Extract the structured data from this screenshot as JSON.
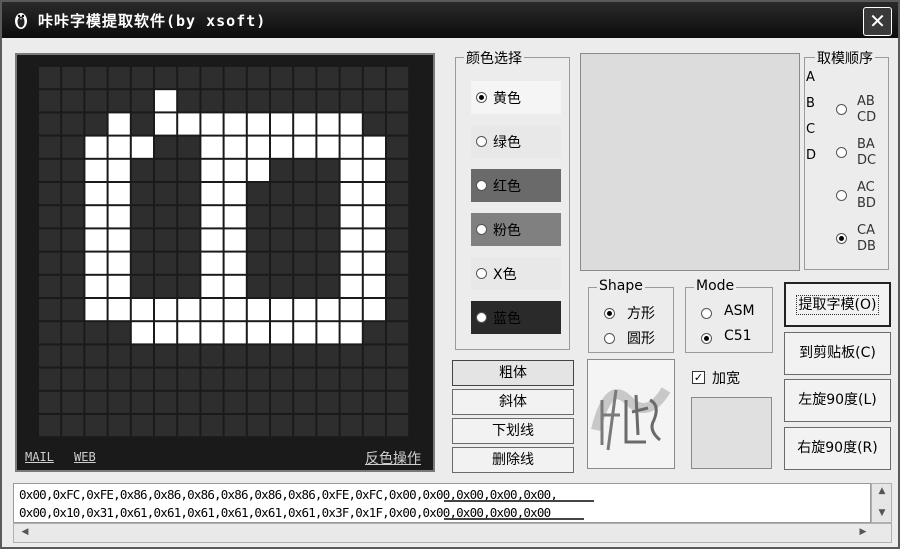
{
  "window": {
    "title": "咔咔字模提取软件(by xsoft)",
    "close_label": "✕"
  },
  "preview": {
    "grid_rows": 16,
    "grid_cols": 16,
    "bitmap": [
      "0000000000000000",
      "0000010000000000",
      "0001011111111100",
      "0011100111111110",
      "0011000111000110",
      "0011000110000110",
      "0011000110000110",
      "0011000110000110",
      "0011000110000110",
      "0011000110000110",
      "0011111111111110",
      "0000111111111100",
      "0000000000000000",
      "0000000000000000",
      "0000000000000000",
      "0000000000000000"
    ],
    "bg_color": "#1a1a1a",
    "cell_off_color": "#2e2e2e",
    "cell_on_color": "#ffffff",
    "mail_link": "MAIL",
    "web_link": "WEB",
    "invert_link": "反色操作"
  },
  "color_select": {
    "title": "颜色选择",
    "options": [
      {
        "label": "黄色",
        "bg": "#f5f5f5",
        "selected": true
      },
      {
        "label": "绿色",
        "bg": "#e8e8e8",
        "selected": false
      },
      {
        "label": "红色",
        "bg": "#6a6a6a",
        "selected": false
      },
      {
        "label": "粉色",
        "bg": "#808080",
        "selected": false
      },
      {
        "label": "X色",
        "bg": "#e8e8e8",
        "selected": false
      },
      {
        "label": "蓝色",
        "bg": "#2a2a2a",
        "selected": false
      }
    ]
  },
  "order": {
    "title": "取模顺序",
    "axis_letters": [
      "A",
      "B",
      "C",
      "D"
    ],
    "options": [
      {
        "line1": "AB",
        "line2": "CD",
        "selected": false
      },
      {
        "line1": "BA",
        "line2": "DC",
        "selected": false
      },
      {
        "line1": "AC",
        "line2": "BD",
        "selected": false
      },
      {
        "line1": "CA",
        "line2": "DB",
        "selected": true
      }
    ]
  },
  "shape": {
    "title": "Shape",
    "options": [
      {
        "label": "方形",
        "selected": true
      },
      {
        "label": "圆形",
        "selected": false
      }
    ]
  },
  "mode": {
    "title": "Mode",
    "options": [
      {
        "label": "ASM",
        "selected": false
      },
      {
        "label": "C51",
        "selected": true
      }
    ]
  },
  "font_style": {
    "buttons": [
      "粗体",
      "斜体",
      "下划线",
      "删除线"
    ]
  },
  "logo_text": "有朋学",
  "widen": {
    "label": "加宽",
    "checked": true
  },
  "actions": {
    "extract": "提取字模(O)",
    "clipboard": "到剪贴板(C)",
    "rotate_left": "左旋90度(L)",
    "rotate_right": "右旋90度(R)"
  },
  "output": {
    "line1": "0x00,0xFC,0xFE,0x86,0x86,0x86,0x86,0x86,0x86,0xFE,0xFC,0x00,0x00,0x00,0x00,0x00,",
    "line2": "0x00,0x10,0x31,0x61,0x61,0x61,0x61,0x61,0x61,0x3F,0x1F,0x00,0x00,0x00,0x00,0x00"
  }
}
